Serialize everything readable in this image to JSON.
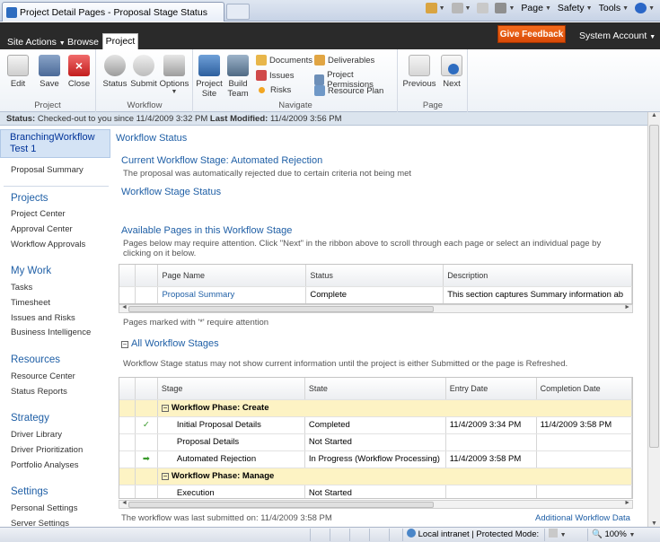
{
  "browser": {
    "tab_title": "Project Detail Pages - Proposal Stage Status",
    "commands": [
      "Page",
      "Safety",
      "Tools"
    ],
    "status": {
      "zone": "Local intranet | Protected Mode: Off",
      "zoom": "100%"
    }
  },
  "ribbon_tabs": {
    "site_actions": "Site Actions",
    "browse": "Browse",
    "project": "Project",
    "give_feedback": "Give Feedback",
    "account": "System Account"
  },
  "ribbon": {
    "project_group": {
      "label": "Project",
      "buttons": [
        "Edit",
        "Save",
        "Close"
      ]
    },
    "workflow_group": {
      "label": "Workflow",
      "buttons": [
        "Status",
        "Submit",
        "Options"
      ]
    },
    "navigate_group": {
      "label": "Navigate",
      "project_site": [
        "Project",
        "Site"
      ],
      "build_team": [
        "Build",
        "Team"
      ],
      "links": [
        "Documents",
        "Issues",
        "Risks",
        "Deliverables",
        "Project Permissions",
        "Resource Plan"
      ]
    },
    "page_group": {
      "label": "Page",
      "buttons": [
        "Previous",
        "Next"
      ]
    }
  },
  "status_bar": {
    "status_label": "Status:",
    "status_text": "Checked-out to you since 11/4/2009 3:32 PM",
    "modified_label": "Last Modified:",
    "modified_text": "11/4/2009 3:56 PM"
  },
  "leftnav": {
    "selected_line1": "BranchingWorkflow",
    "selected_line2": "Test 1",
    "proposal_summary": "Proposal Summary",
    "sections": [
      {
        "head": "Projects",
        "items": [
          "Project Center",
          "Approval Center",
          "Workflow Approvals"
        ]
      },
      {
        "head": "My Work",
        "items": [
          "Tasks",
          "Timesheet",
          "Issues and Risks",
          "Business Intelligence"
        ]
      },
      {
        "head": "Resources",
        "items": [
          "Resource Center",
          "Status Reports"
        ]
      },
      {
        "head": "Strategy",
        "items": [
          "Driver Library",
          "Driver Prioritization",
          "Portfolio Analyses"
        ]
      },
      {
        "head": "Settings",
        "items": [
          "Personal Settings",
          "Server Settings"
        ]
      }
    ]
  },
  "main": {
    "workflow_status": "Workflow Status",
    "current_stage_title": "Current Workflow Stage: Automated Rejection",
    "current_stage_desc": "The proposal was automatically rejected due to certain criteria not being met",
    "stage_status": "Workflow Stage Status",
    "available_pages_title": "Available Pages in this Workflow Stage",
    "available_pages_desc": "Pages below may require attention. Click \"Next\" in the ribbon above to scroll through each page or select an individual page by clicking on it below.",
    "pages_table": {
      "headers": [
        "Page Name",
        "Status",
        "Description"
      ],
      "rows": [
        {
          "name": "Proposal Summary",
          "status": "Complete",
          "description": "This section captures Summary information ab"
        }
      ]
    },
    "pages_note": "Pages marked with '*' require attention",
    "all_stages_title": "All Workflow Stages",
    "all_stages_desc": "Workflow Stage status may not show current information until the project is either Submitted or the page is Refreshed.",
    "stages_table": {
      "headers": [
        "Stage",
        "State",
        "Entry Date",
        "Completion Date"
      ],
      "phase1": "Workflow Phase: Create",
      "phase2": "Workflow Phase: Manage",
      "rows1": [
        {
          "icon": "check-icon",
          "stage": "Initial Proposal Details",
          "state": "Completed",
          "entry": "11/4/2009 3:34 PM",
          "completion": "11/4/2009 3:58 PM"
        },
        {
          "icon": "",
          "stage": "Proposal Details",
          "state": "Not Started",
          "entry": "",
          "completion": ""
        },
        {
          "icon": "arrow-icon",
          "stage": "Automated Rejection",
          "state": "In Progress (Workflow Processing)",
          "entry": "11/4/2009 3:58 PM",
          "completion": ""
        }
      ],
      "rows2": [
        {
          "icon": "",
          "stage": "Execution",
          "state": "Not Started",
          "entry": "",
          "completion": ""
        }
      ]
    },
    "footer_text": "The workflow was last submitted on: 11/4/2009 3:58 PM",
    "additional_link": "Additional Workflow Data"
  },
  "colors": {
    "link_blue": "#1f5fa6",
    "feedback_orange": "#e8560f",
    "phase_yellow": "#fdf3c4",
    "nav_selected": "#d4e3f5"
  }
}
